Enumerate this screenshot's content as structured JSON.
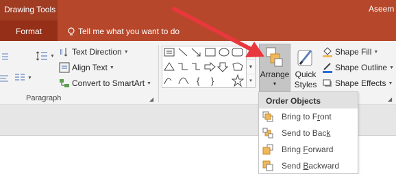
{
  "titlebar": {
    "context_tab_group": "Drawing Tools",
    "user_name": "Aseem"
  },
  "tabs": {
    "format": "Format",
    "tell_me": "Tell me what you want to do"
  },
  "paragraph": {
    "text_direction": "Text Direction",
    "align_text": "Align Text",
    "convert_smartart": "Convert to SmartArt",
    "group_label": "Paragraph"
  },
  "shapes": {
    "gallery_icons": [
      "text-box-icon",
      "line-icon",
      "arrow-line-icon",
      "rectangle-icon",
      "oval-icon",
      "rounded-rectangle-icon",
      "triangle-icon",
      "elbow-connector-icon",
      "elbow-arrow-icon",
      "right-arrow-icon",
      "down-arrow-icon",
      "pentagon-icon",
      "curve-icon",
      "arc-icon",
      "left-brace-icon",
      "right-brace-icon",
      "star-icon"
    ]
  },
  "drawing": {
    "arrange_label": "Arrange",
    "quick_styles_line1": "Quick",
    "quick_styles_line2": "Styles",
    "shape_fill": "Shape Fill",
    "shape_outline": "Shape Outline",
    "shape_effects": "Shape Effects"
  },
  "order_menu": {
    "header": "Order Objects",
    "items": [
      {
        "pre": "Bring to F",
        "key": "r",
        "post": "ont"
      },
      {
        "pre": "Send to Bac",
        "key": "k",
        "post": ""
      },
      {
        "pre": "Bring ",
        "key": "F",
        "post": "orward"
      },
      {
        "pre": "Send ",
        "key": "B",
        "post": "ackward"
      }
    ]
  },
  "colors": {
    "ribbon_accent": "#b7472a",
    "arrow": "#e8383d",
    "selected_button": "#c5c5c5"
  }
}
